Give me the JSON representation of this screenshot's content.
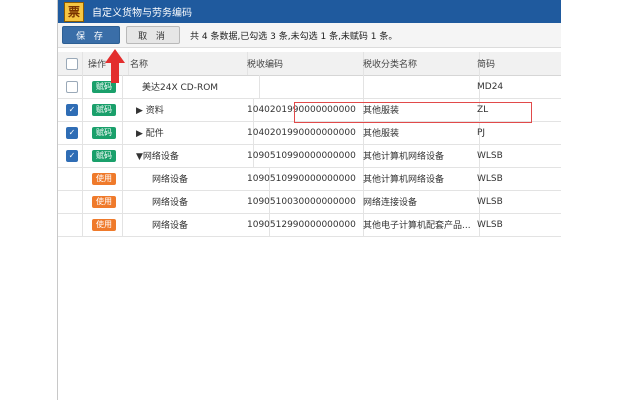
{
  "window": {
    "title": "自定义货物与劳务编码",
    "logo_glyph": "票"
  },
  "toolbar": {
    "save_label": "保 存",
    "cancel_label": "取 消",
    "status_text": "共 4 条数据,已勾选 3 条,未勾选 1 条,未赋码 1 条。"
  },
  "table": {
    "headers": [
      "操作",
      "名称",
      "税收编码",
      "税收分类名称",
      "简码"
    ],
    "rows": [
      {
        "checked": false,
        "action": "赋码",
        "action_color": "#1aa06b",
        "name": "美达24X CD-ROM",
        "tax_code": "",
        "tax_class": "",
        "short": "MD24"
      },
      {
        "checked": true,
        "action": "赋码",
        "action_color": "#1aa06b",
        "name": "▶ 资料",
        "tax_code": "1040201990000000000",
        "tax_class": "其他服装",
        "short": "ZL"
      },
      {
        "checked": true,
        "action": "赋码",
        "action_color": "#1aa06b",
        "name": "▶ 配件",
        "tax_code": "1040201990000000000",
        "tax_class": "其他服装",
        "short": "PJ"
      },
      {
        "checked": true,
        "action": "赋码",
        "action_color": "#1aa06b",
        "name": "▼网络设备",
        "tax_code": "1090510990000000000",
        "tax_class": "其他计算机网络设备",
        "short": "WLSB"
      },
      {
        "checked": null,
        "action": "使用",
        "action_color": "#ef7a2b",
        "name": "网络设备",
        "tax_code": "1090510990000000000",
        "tax_class": "其他计算机网络设备",
        "short": "WLSB"
      },
      {
        "checked": null,
        "action": "使用",
        "action_color": "#ef7a2b",
        "name": "网络设备",
        "tax_code": "1090510030000000000",
        "tax_class": "网络连接设备",
        "short": "WLSB"
      },
      {
        "checked": null,
        "action": "使用",
        "action_color": "#ef7a2b",
        "name": "网络设备",
        "tax_code": "1090512990000000000",
        "tax_class": "其他电子计算机配套产品...",
        "short": "WLSB"
      }
    ]
  }
}
